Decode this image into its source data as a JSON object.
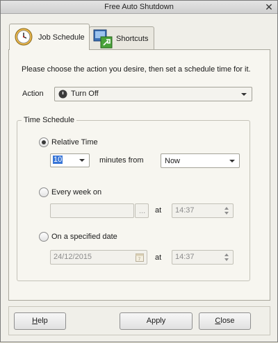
{
  "window": {
    "title": "Free Auto Shutdown",
    "close_glyph": "✕"
  },
  "tabs": [
    {
      "label": "Job Schedule",
      "icon": "clock-icon",
      "active": true
    },
    {
      "label": "Shortcuts",
      "icon": "shortcuts-icon",
      "active": false
    }
  ],
  "instruction": "Please choose the action you desire, then set a schedule time for it.",
  "action": {
    "label": "Action",
    "value": "Turn Off"
  },
  "time_schedule": {
    "legend": "Time Schedule",
    "relative": {
      "label": "Relative Time",
      "selected": true,
      "minutes_value": "10",
      "minutes_from_label": "minutes from",
      "from_value": "Now"
    },
    "weekly": {
      "label": "Every week on",
      "selected": false,
      "days_value": "",
      "browse_label": "...",
      "at_label": "at",
      "time_value": "14:37"
    },
    "specified": {
      "label": "On a specified date",
      "selected": false,
      "date_value": "24/12/2015",
      "at_label": "at",
      "time_value": "14:37"
    }
  },
  "buttons": {
    "help": {
      "h": "H",
      "rest": "elp"
    },
    "apply": "Apply",
    "close": {
      "h": "C",
      "rest": "lose"
    }
  }
}
